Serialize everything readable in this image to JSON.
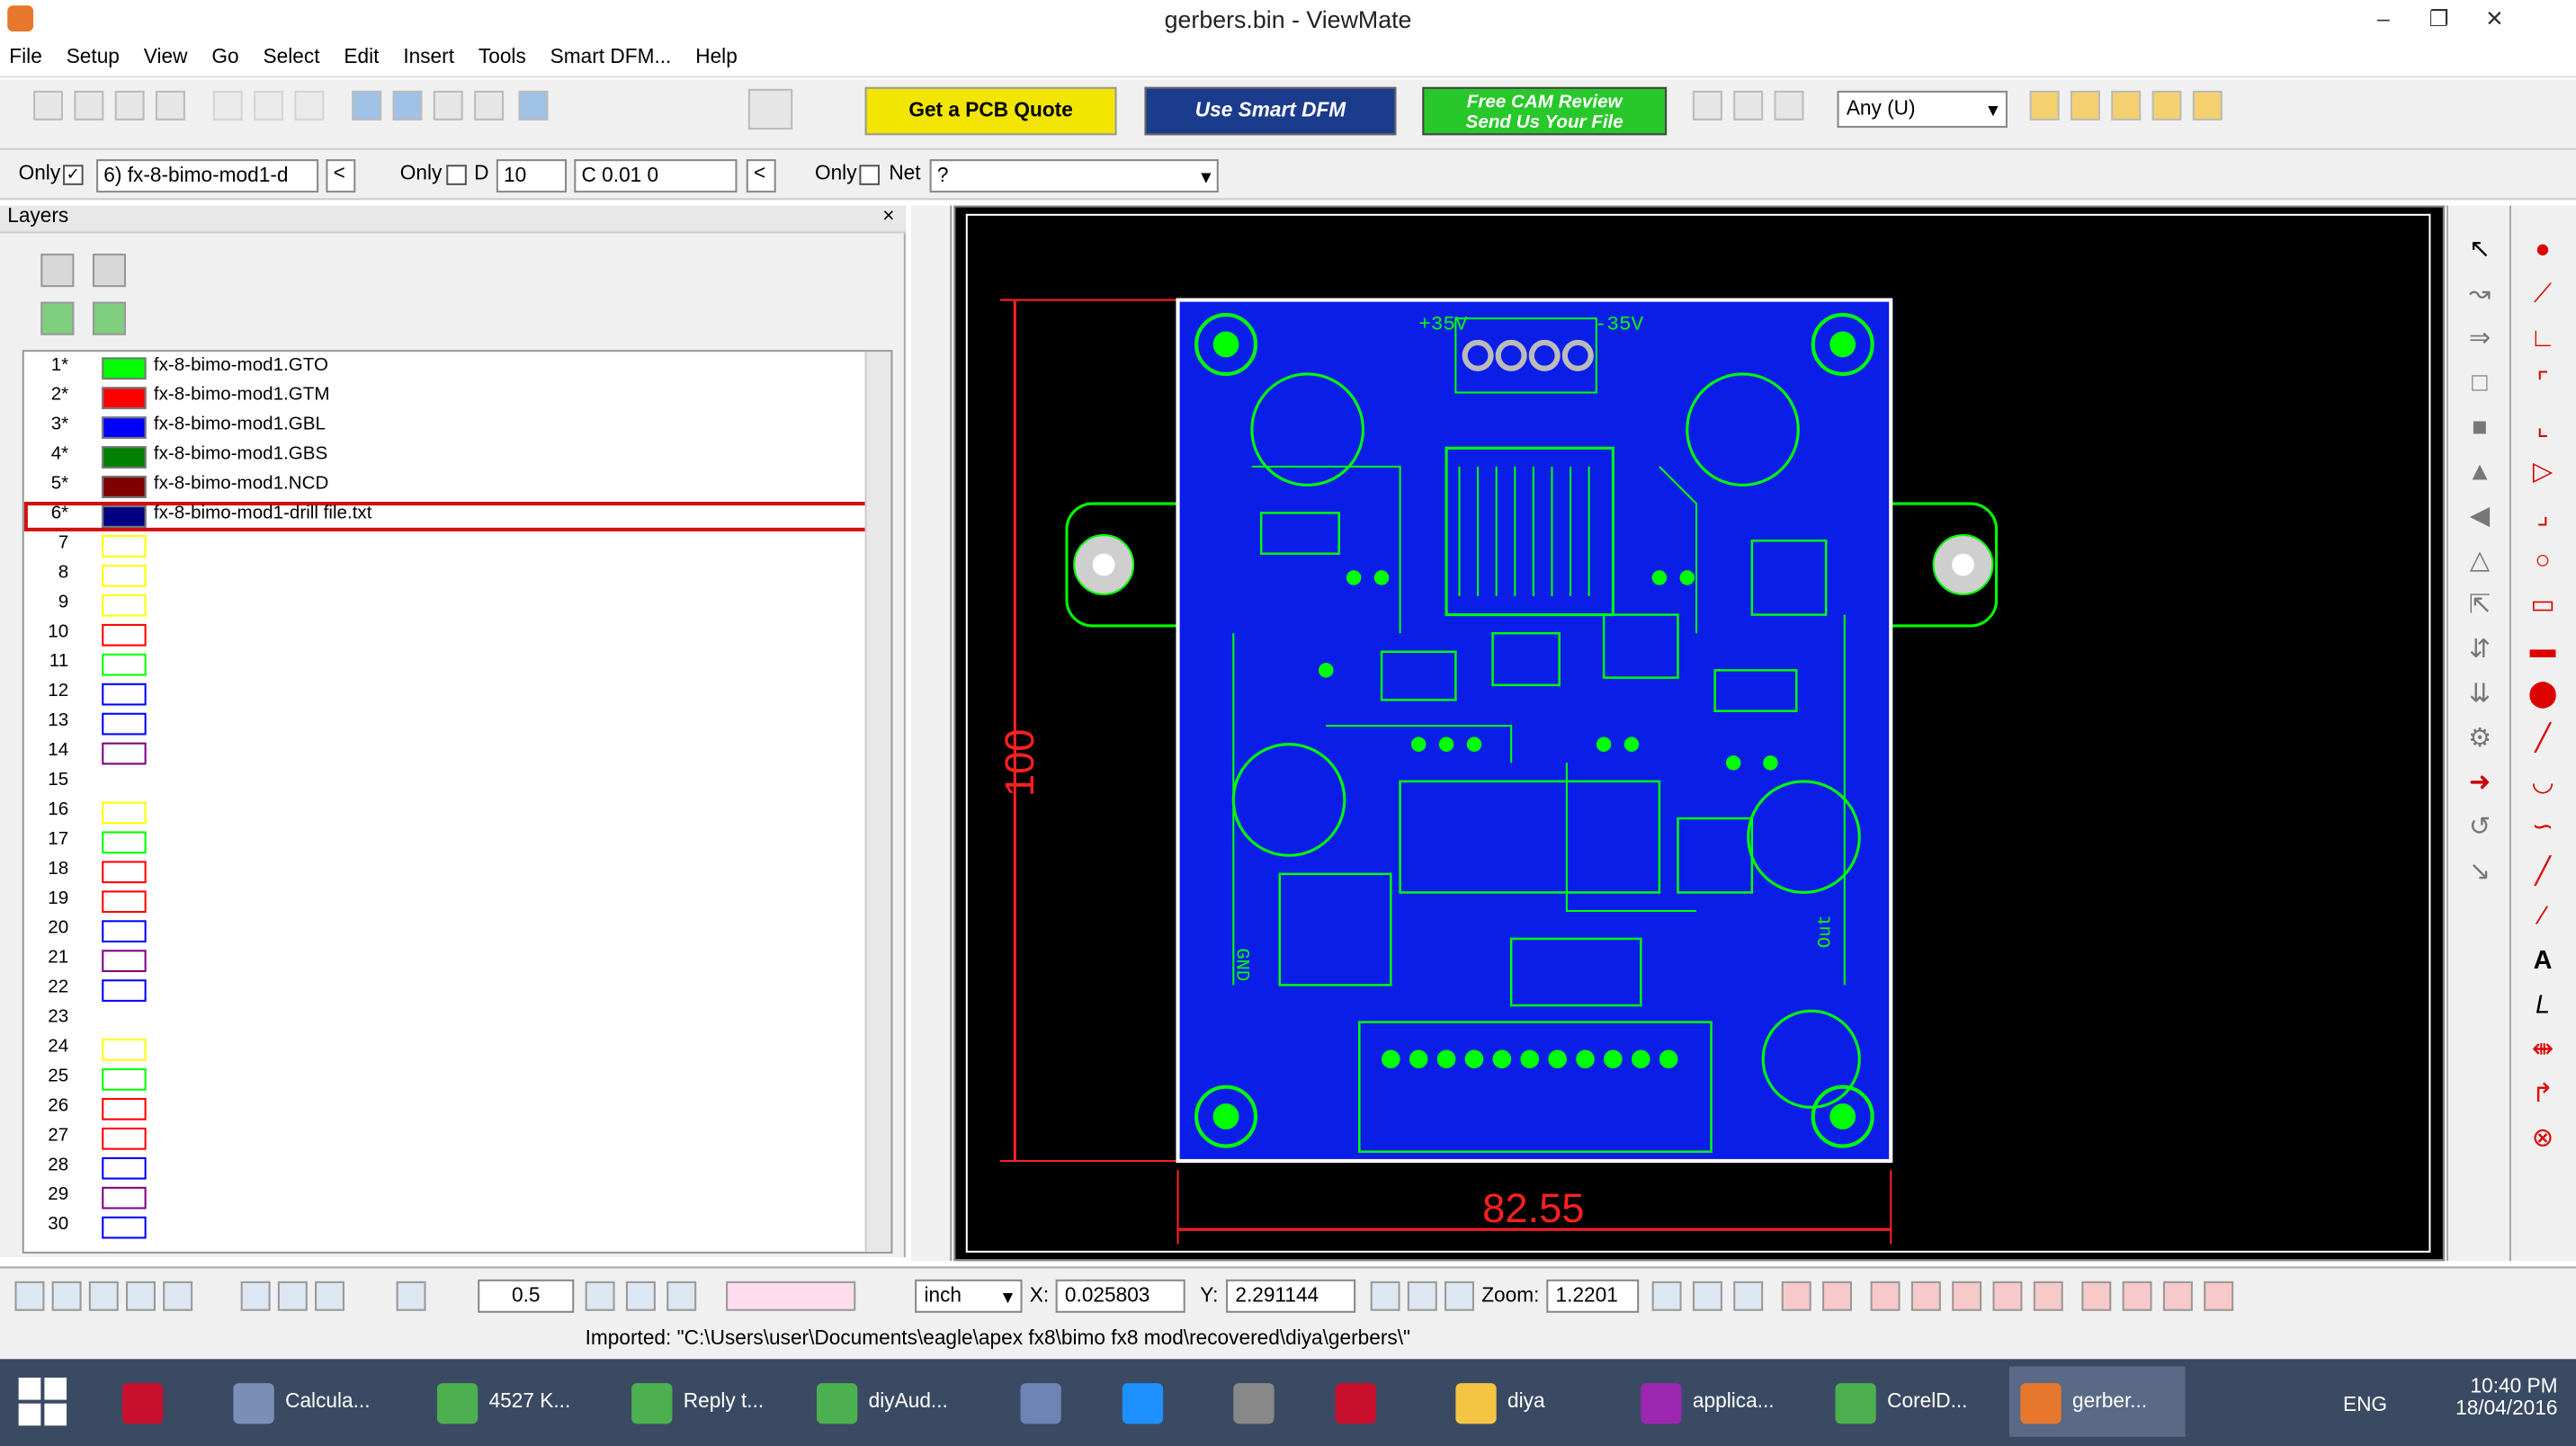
{
  "window": {
    "title": "gerbers.bin - ViewMate"
  },
  "menu": [
    "File",
    "Setup",
    "View",
    "Go",
    "Select",
    "Edit",
    "Insert",
    "Tools",
    "Smart DFM...",
    "Help"
  ],
  "toolbar": {
    "pcb_quote": "Get a PCB Quote",
    "smart_dfm": "Use Smart DFM",
    "free_cam_line1": "Free CAM Review",
    "free_cam_line2": "Send Us Your File",
    "any_select": "Any   (U)"
  },
  "filter": {
    "only1": "Only",
    "layer_select": "6) fx-8-bimo-mod1-d",
    "only2": "Only",
    "d_label": "D",
    "d_value": "10",
    "c_value": "C 0.01  0",
    "only3": "Only",
    "net_label": "Net",
    "net_value": "?"
  },
  "layers_panel": {
    "title": "Layers",
    "close": "×",
    "rows": [
      {
        "num": "1*",
        "color": "#00ff00",
        "name": "fx-8-bimo-mod1.GTO"
      },
      {
        "num": "2*",
        "color": "#ff0000",
        "name": "fx-8-bimo-mod1.GTM"
      },
      {
        "num": "3*",
        "color": "#0000ff",
        "name": "fx-8-bimo-mod1.GBL"
      },
      {
        "num": "4*",
        "color": "#008000",
        "name": "fx-8-bimo-mod1.GBS"
      },
      {
        "num": "5*",
        "color": "#800000",
        "name": "fx-8-bimo-mod1.NCD"
      },
      {
        "num": "6*",
        "color": "#000080",
        "name": "fx-8-bimo-mod1-drill file.txt"
      },
      {
        "num": "7",
        "color": "#ffff00",
        "name": ""
      },
      {
        "num": "8",
        "color": "#ffff00",
        "name": ""
      },
      {
        "num": "9",
        "color": "#ffff00",
        "name": ""
      },
      {
        "num": "10",
        "color": "#ff0000",
        "name": ""
      },
      {
        "num": "11",
        "color": "#00ff00",
        "name": ""
      },
      {
        "num": "12",
        "color": "#0000ff",
        "name": ""
      },
      {
        "num": "13",
        "color": "#0000ff",
        "name": ""
      },
      {
        "num": "14",
        "color": "#800080",
        "name": ""
      },
      {
        "num": "15",
        "color": "#ffffff",
        "name": ""
      },
      {
        "num": "16",
        "color": "#ffff00",
        "name": ""
      },
      {
        "num": "17",
        "color": "#00ff00",
        "name": ""
      },
      {
        "num": "18",
        "color": "#ff0000",
        "name": ""
      },
      {
        "num": "19",
        "color": "#ff0000",
        "name": ""
      },
      {
        "num": "20",
        "color": "#0000ff",
        "name": ""
      },
      {
        "num": "21",
        "color": "#800080",
        "name": ""
      },
      {
        "num": "22",
        "color": "#0000ff",
        "name": ""
      },
      {
        "num": "23",
        "color": "#ffffff",
        "name": ""
      },
      {
        "num": "24",
        "color": "#ffff00",
        "name": ""
      },
      {
        "num": "25",
        "color": "#00ff00",
        "name": ""
      },
      {
        "num": "26",
        "color": "#ff0000",
        "name": ""
      },
      {
        "num": "27",
        "color": "#ff0000",
        "name": ""
      },
      {
        "num": "28",
        "color": "#0000ff",
        "name": ""
      },
      {
        "num": "29",
        "color": "#800080",
        "name": ""
      },
      {
        "num": "30",
        "color": "#0000ff",
        "name": ""
      }
    ]
  },
  "pcb": {
    "dim_width": "82.55",
    "dim_height": "100",
    "label_plus": "+35V",
    "label_minus": "-35V",
    "label_gnd": "GND",
    "label_out": "Out"
  },
  "status": {
    "zoom_step": "0.5",
    "units": "inch",
    "x_label": "X:",
    "x_value": "0.025803",
    "y_label": "Y:",
    "y_value": "2.291144",
    "zoom_label": "Zoom:",
    "zoom_value": "1.2201",
    "imported": "Imported: \"C:\\Users\\user\\Documents\\eagle\\apex fx8\\bimo fx8 mod\\recovered\\diya\\gerbers\\\""
  },
  "taskbar": {
    "items": [
      {
        "label": "",
        "color": "#c8102e"
      },
      {
        "label": "Calcula...",
        "color": "#7a8fb5"
      },
      {
        "label": "4527 K...",
        "color": "#4caf50"
      },
      {
        "label": "Reply t...",
        "color": "#4caf50"
      },
      {
        "label": "diyAud...",
        "color": "#4caf50"
      },
      {
        "label": "",
        "color": "#6d84b4"
      },
      {
        "label": "",
        "color": "#1e90ff"
      },
      {
        "label": "",
        "color": "#888888"
      },
      {
        "label": "",
        "color": "#c8102e"
      },
      {
        "label": "diya",
        "color": "#f4c542"
      },
      {
        "label": "applica...",
        "color": "#9c27b0"
      },
      {
        "label": "CorelD...",
        "color": "#4caf50"
      },
      {
        "label": "gerber...",
        "color": "#e8772e"
      }
    ],
    "lang": "ENG",
    "time": "10:40 PM",
    "date": "18/04/2016"
  }
}
